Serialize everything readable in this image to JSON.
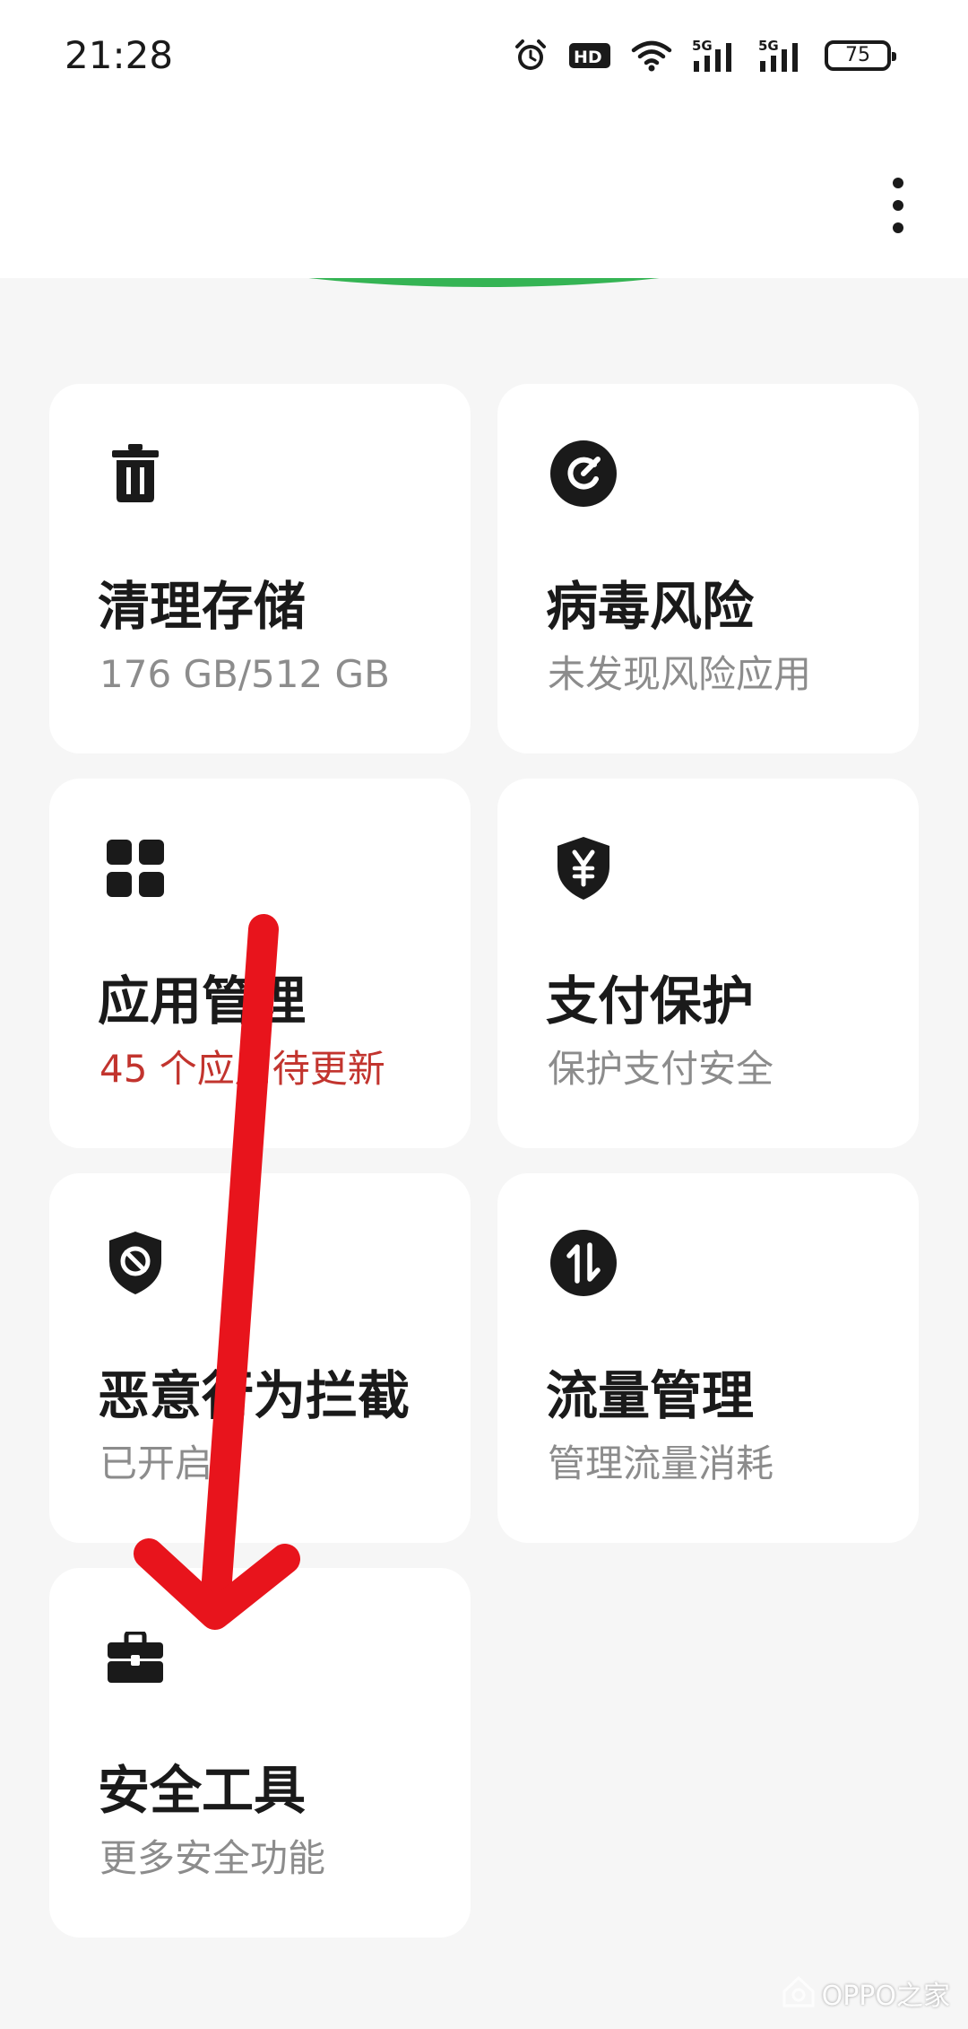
{
  "status_bar": {
    "time": "21:28",
    "icons": [
      "alarm-icon",
      "hd-icon",
      "wifi-icon",
      "signal-5g-icon",
      "signal-5g-icon"
    ],
    "hd_label": "HD",
    "network_label": "5G",
    "battery_level": "75"
  },
  "header": {
    "more_icon": "more-vertical-icon"
  },
  "cards": [
    {
      "icon": "trash-icon",
      "title": "清理存储",
      "subtitle": "176 GB/512 GB",
      "alert": false
    },
    {
      "icon": "virus-scan-icon",
      "title": "病毒风险",
      "subtitle": "未发现风险应用",
      "alert": false
    },
    {
      "icon": "apps-grid-icon",
      "title": "应用管理",
      "subtitle": "45 个应用待更新",
      "alert": true
    },
    {
      "icon": "payment-shield-icon",
      "title": "支付保护",
      "subtitle": "保护支付安全",
      "alert": false
    },
    {
      "icon": "block-shield-icon",
      "title": "恶意行为拦截",
      "subtitle": "已开启",
      "alert": false
    },
    {
      "icon": "data-traffic-icon",
      "title": "流量管理",
      "subtitle": "管理流量消耗",
      "alert": false
    },
    {
      "icon": "toolbox-icon",
      "title": "安全工具",
      "subtitle": "更多安全功能",
      "alert": false
    }
  ],
  "colors": {
    "accent_green": "#35b454",
    "alert_red": "#c2342e",
    "annotation_red": "#e8141c",
    "background": "#f6f6f6"
  },
  "watermark": {
    "text": "OPPO之家"
  }
}
